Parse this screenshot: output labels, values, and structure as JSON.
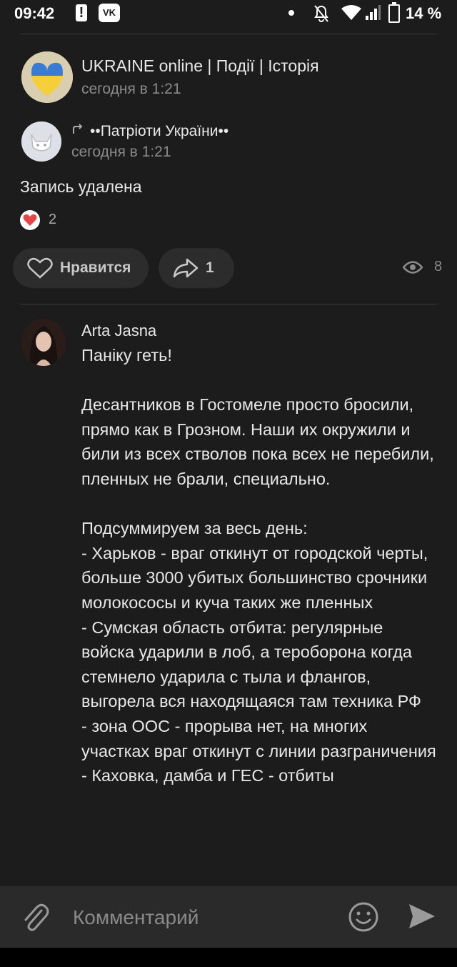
{
  "status_bar": {
    "time": "09:42",
    "alert_glyph": "!",
    "vk_glyph": "VK",
    "battery": "14 %"
  },
  "post": {
    "group_title": "UKRAINE online | Події | Історія",
    "group_time": "сегодня в 1:21",
    "repost_title": "••Патріоти України••",
    "repost_time": "сегодня в 1:21",
    "text": "Запись удалена",
    "reactions_count": "2",
    "like_label": "Нравится",
    "share_count": "1",
    "views_count": "8"
  },
  "comment": {
    "author": "Arta Jasna",
    "text": "Паніку геть!\n\nДесантников в Гостомеле просто бросили, прямо как в Грозном. Наши их окружили и били из всех стволов пока всех не перебили, пленных не брали, специально.\n\nПодсуммируем за весь день:\n- Харьков - враг откинут от городской черты, больше 3000 убитых большинство срочники молокососы и куча таких же пленных\n- Сумская область отбита: регулярные войска ударили в лоб, а тероборона когда стемнело ударила с тыла и флангов, выгорела вся находящаяся там техника РФ\n- зона ООС - прорыва нет, на многих участках враг откинут с линии разграничения\n- Каховка, дамба и ГЕС - отбиты"
  },
  "input": {
    "placeholder": "Комментарий"
  },
  "colors": {
    "background": "#1c1c1c",
    "input_bar": "#2a2a2a",
    "heart": "#e64646",
    "muted_text": "#8a8a8a"
  },
  "icons": [
    "alert-icon",
    "vk-icon",
    "bell-off-icon",
    "wifi-icon",
    "signal-icon",
    "battery-icon",
    "repost-icon",
    "heart-icon",
    "share-icon",
    "eye-icon",
    "attach-icon",
    "emoji-icon",
    "send-icon"
  ]
}
